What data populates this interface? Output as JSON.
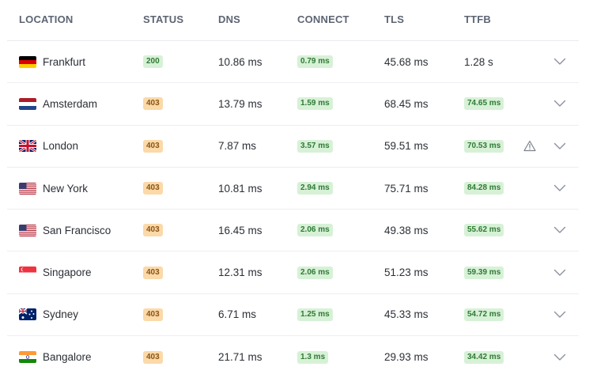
{
  "columns": {
    "location": "LOCATION",
    "status": "STATUS",
    "dns": "DNS",
    "connect": "CONNECT",
    "tls": "TLS",
    "ttfb": "TTFB"
  },
  "rows": [
    {
      "flag": "de",
      "location": "Frankfurt",
      "status": "200",
      "status_kind": "ok",
      "dns": "10.86 ms",
      "connect": "0.79 ms",
      "tls": "45.68 ms",
      "ttfb": "1.28 s",
      "ttfb_badge": false,
      "warning": false
    },
    {
      "flag": "nl",
      "location": "Amsterdam",
      "status": "403",
      "status_kind": "warn",
      "dns": "13.79 ms",
      "connect": "1.59 ms",
      "tls": "68.45 ms",
      "ttfb": "74.65 ms",
      "ttfb_badge": true,
      "warning": false
    },
    {
      "flag": "gb",
      "location": "London",
      "status": "403",
      "status_kind": "warn",
      "dns": "7.87 ms",
      "connect": "3.57 ms",
      "tls": "59.51 ms",
      "ttfb": "70.53 ms",
      "ttfb_badge": true,
      "warning": true
    },
    {
      "flag": "us",
      "location": "New York",
      "status": "403",
      "status_kind": "warn",
      "dns": "10.81 ms",
      "connect": "2.94 ms",
      "tls": "75.71 ms",
      "ttfb": "84.28 ms",
      "ttfb_badge": true,
      "warning": false
    },
    {
      "flag": "us",
      "location": "San Francisco",
      "status": "403",
      "status_kind": "warn",
      "dns": "16.45 ms",
      "connect": "2.06 ms",
      "tls": "49.38 ms",
      "ttfb": "55.62 ms",
      "ttfb_badge": true,
      "warning": false
    },
    {
      "flag": "sg",
      "location": "Singapore",
      "status": "403",
      "status_kind": "warn",
      "dns": "12.31 ms",
      "connect": "2.06 ms",
      "tls": "51.23 ms",
      "ttfb": "59.39 ms",
      "ttfb_badge": true,
      "warning": false
    },
    {
      "flag": "au",
      "location": "Sydney",
      "status": "403",
      "status_kind": "warn",
      "dns": "6.71 ms",
      "connect": "1.25 ms",
      "tls": "45.33 ms",
      "ttfb": "54.72 ms",
      "ttfb_badge": true,
      "warning": false
    },
    {
      "flag": "in",
      "location": "Bangalore",
      "status": "403",
      "status_kind": "warn",
      "dns": "21.71 ms",
      "connect": "1.3 ms",
      "tls": "29.93 ms",
      "ttfb": "34.42 ms",
      "ttfb_badge": true,
      "warning": false
    }
  ],
  "icons": {
    "expand": "chevron-down-icon",
    "warning": "warning-triangle-icon"
  },
  "colors": {
    "ok_bg": "#d7f1d7",
    "ok_text": "#2f7a34",
    "warn_bg": "#fbd9a8",
    "warn_text": "#8b5413"
  }
}
